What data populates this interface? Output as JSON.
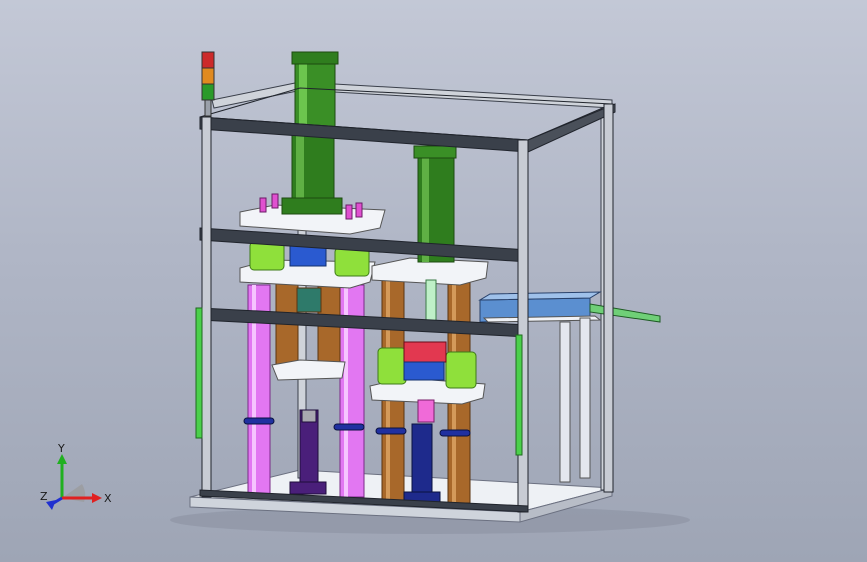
{
  "viewport": {
    "background_top": "#c3c8d6",
    "background_bottom": "#9ea5b5",
    "model_description_colors": {
      "frame": "#c8ccd4",
      "green_cylinder": "#2f7d1e",
      "magenta_column": "#e277f2",
      "brown_column": "#a8682a",
      "lime_bushing": "#8fe03b",
      "navy_column": "#1e2a8c",
      "purple_column": "#4a1f7a",
      "plate": "#ecf0f5"
    }
  },
  "triad": {
    "x_label": "X",
    "y_label": "Y",
    "z_label": "Z",
    "x_color": "#e02020",
    "y_color": "#20b020",
    "z_color": "#2030d0"
  },
  "tower_light": {
    "colors": [
      "#cc2a2a",
      "#e08a20",
      "#2a9a2a"
    ]
  }
}
